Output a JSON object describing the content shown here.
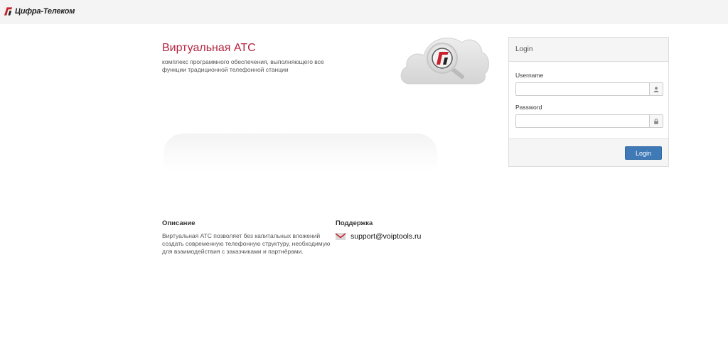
{
  "header": {
    "brand_name": "Цифра-Телеком",
    "logo_icon": "brand-logo-icon"
  },
  "hero": {
    "title": "Виртуальная АТС",
    "subtitle": "комплекс программного обеспечения, выполняющего все функции традиционной телефонной станции",
    "graphic_icon": "cloud-icon"
  },
  "login": {
    "panel_title": "Login",
    "username_label": "Username",
    "username_value": "",
    "username_icon": "user-icon",
    "password_label": "Password",
    "password_value": "",
    "password_icon": "lock-icon",
    "button_label": "Login"
  },
  "description": {
    "title": "Описание",
    "text": "Виртуальная АТС позволяет без капитальных вложений создать современную телефонную структуру, необходимую для взаимодействия с заказчиками и партнёрами."
  },
  "support": {
    "title": "Поддержка",
    "email": "support@voiptools.ru",
    "icon": "mail-icon"
  },
  "colors": {
    "accent": "#b3233f",
    "button": "#3f7ab6",
    "topbar": "#f4f4f4"
  }
}
